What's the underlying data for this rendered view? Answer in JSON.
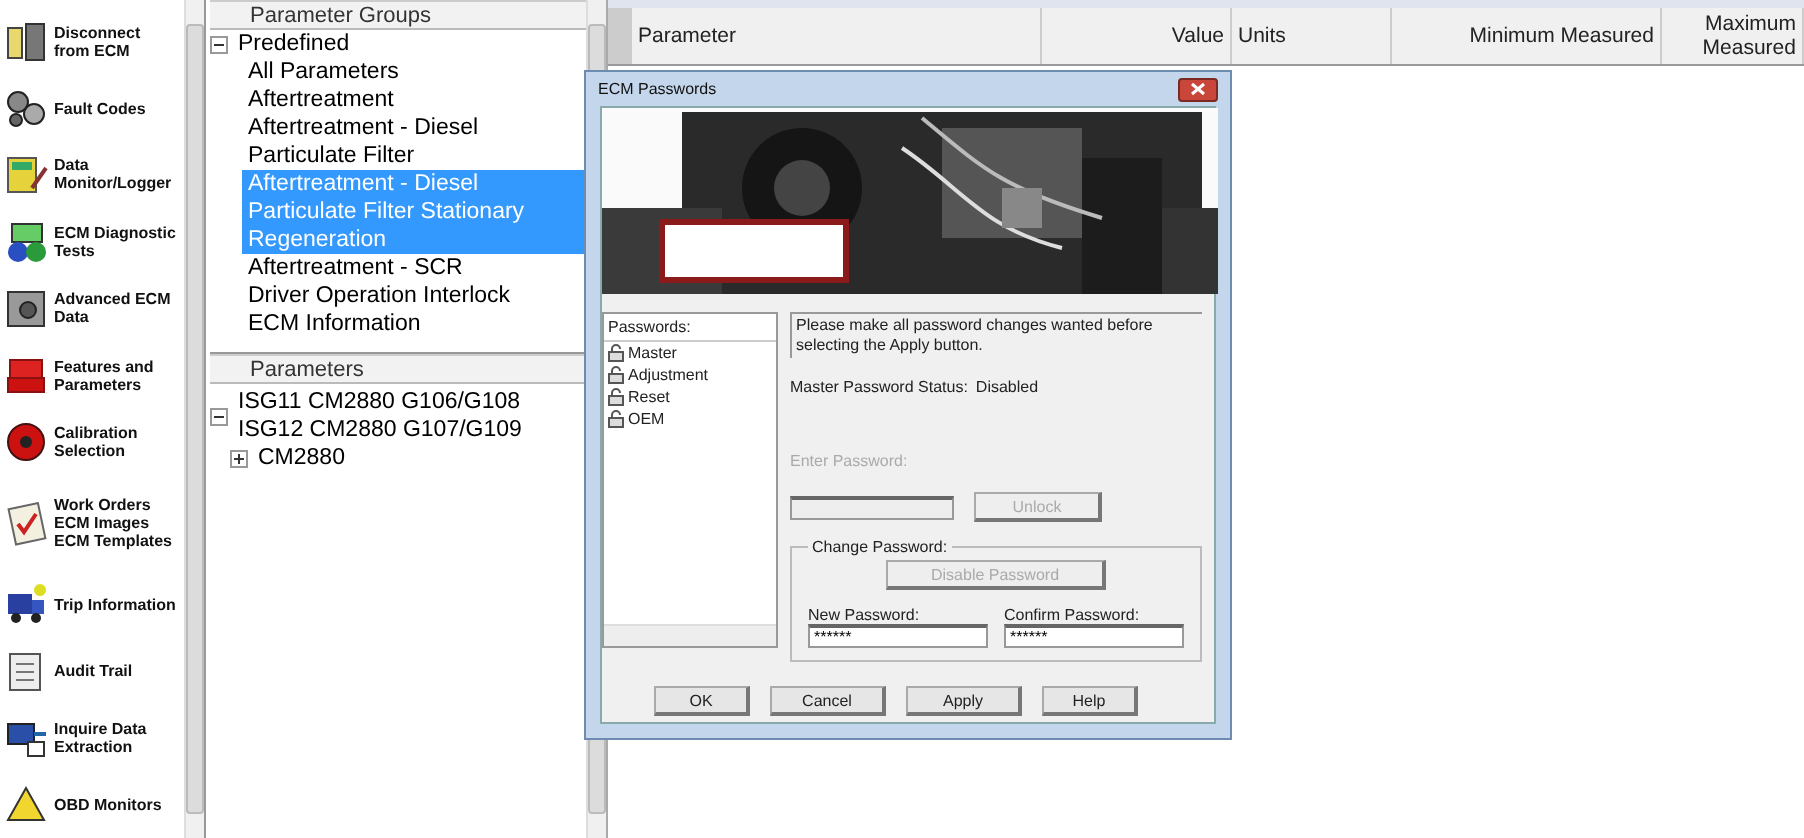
{
  "sidebar": {
    "items": [
      {
        "label": "Disconnect from ECM"
      },
      {
        "label": "Fault Codes"
      },
      {
        "label": "Data Monitor/Logger"
      },
      {
        "label": "ECM Diagnostic Tests"
      },
      {
        "label": "Advanced ECM Data"
      },
      {
        "label": "Features and Parameters"
      },
      {
        "label": "Calibration Selection"
      },
      {
        "label": "Work Orders ECM Images ECM Templates"
      },
      {
        "label": "Trip Information"
      },
      {
        "label": "Audit Trail"
      },
      {
        "label": "Inquire Data Extraction"
      },
      {
        "label": "OBD Monitors"
      }
    ]
  },
  "parameter_groups": {
    "heading": "Parameter Groups",
    "tree": [
      {
        "label": "Predefined",
        "expanded": true,
        "children": [
          {
            "label": "All Parameters",
            "selected": false
          },
          {
            "label": "Aftertreatment",
            "selected": false
          },
          {
            "label": "Aftertreatment - Diesel Particulate Filter",
            "selected": false
          },
          {
            "label": "Aftertreatment - Diesel Particulate Filter Stationary Regeneration",
            "selected": true
          },
          {
            "label": "Aftertreatment - SCR",
            "selected": false
          },
          {
            "label": "Driver Operation Interlock",
            "selected": false
          },
          {
            "label": "ECM Information",
            "selected": false
          }
        ]
      }
    ]
  },
  "parameters": {
    "heading": "Parameters",
    "tree": [
      {
        "label": "ISG11 CM2880 G106/G108 ISG12 CM2880 G107/G109",
        "expanded": true,
        "children": [
          {
            "label": "CM2880",
            "expanded": false
          }
        ]
      }
    ]
  },
  "table": {
    "columns": [
      "Parameter",
      "Value",
      "Units",
      "Minimum Measured",
      "Maximum Measured"
    ]
  },
  "dialog": {
    "title": "ECM Passwords",
    "passwords": {
      "heading": "Passwords:",
      "items": [
        "Master",
        "Adjustment",
        "Reset",
        "OEM"
      ]
    },
    "message": "Please make all password changes wanted before selecting the Apply button.",
    "status_label": "Master Password Status:",
    "status_value": "Disabled",
    "enter_password": {
      "label": "Enter Password:",
      "disabled": true
    },
    "unlock_button": {
      "label": "Unlock",
      "disabled": true
    },
    "change_password": {
      "title": "Change Password:",
      "disable_button": {
        "label": "Disable Password",
        "disabled": true
      },
      "new_password": {
        "label": "New Password:",
        "value": "******"
      },
      "confirm_password": {
        "label": "Confirm Password:",
        "value": "******"
      }
    },
    "buttons": [
      "OK",
      "Cancel",
      "Apply",
      "Help"
    ]
  }
}
